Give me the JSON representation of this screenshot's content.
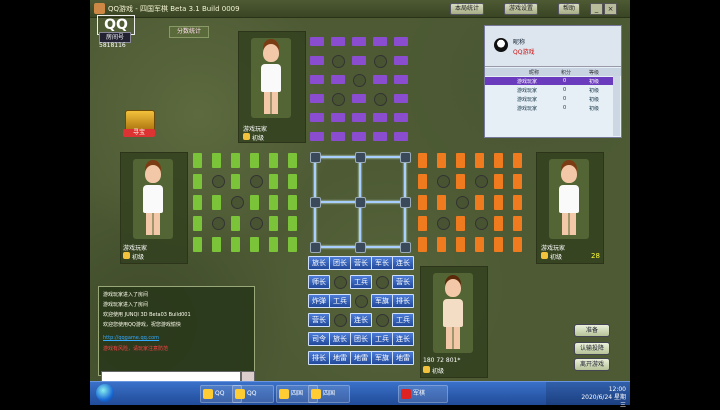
{
  "window": {
    "title": "QQ游戏 - 四国军棋   Beta 3.1 Build 0009",
    "buttons": [
      "本局统计",
      "游戏设置",
      "帮助"
    ]
  },
  "logo": "QQ",
  "room": {
    "badge": "房间号",
    "id": "5818116"
  },
  "stats_button": "分数统计",
  "treasure": {
    "label": "寻宝"
  },
  "players": {
    "top": {
      "name": "游戏玩家",
      "level": "初级"
    },
    "left": {
      "name": "游戏玩家",
      "level": "初级"
    },
    "right": {
      "name": "游戏玩家",
      "level": "初级",
      "count": "28"
    },
    "bottom": {
      "name": "180 72 801*",
      "level": "初级"
    }
  },
  "pieces": [
    [
      "旅长",
      "团长",
      "营长",
      "军长",
      "连长"
    ],
    [
      "师长",
      "",
      "工兵",
      "",
      "营长"
    ],
    [
      "炸弹",
      "工兵",
      "",
      "军旗",
      "排长"
    ],
    [
      "营长",
      "",
      "连长",
      "",
      "工兵"
    ],
    [
      "司令",
      "旅长",
      "团长",
      "工兵",
      "连长"
    ],
    [
      "排长",
      "地雷",
      "地雷",
      "军旗",
      "地雷"
    ]
  ],
  "player_list": {
    "title": "昵称",
    "subtitle": "QQ游戏",
    "columns": [
      "昵称",
      "积分",
      "等级"
    ],
    "rows": [
      {
        "name": "游戏玩家",
        "score": "0",
        "level": "初级"
      },
      {
        "name": "游戏玩家",
        "score": "0",
        "level": "初级"
      },
      {
        "name": "游戏玩家",
        "score": "0",
        "level": "初级"
      },
      {
        "name": "游戏玩家",
        "score": "0",
        "level": "初级"
      }
    ]
  },
  "chat": [
    {
      "text": "游戏玩家进入了房间",
      "style": "normal"
    },
    {
      "text": "游戏玩家进入了房间",
      "style": "normal"
    },
    {
      "text": "欢迎使用 JUNQI 3D  Beta03 Build001",
      "style": "normal"
    },
    {
      "text": "欢迎您使用QQ游戏，祝您游戏愉快",
      "style": "normal"
    },
    {
      "text": "http://qqgame.qq.com",
      "style": "link"
    },
    {
      "text": "游戏有风险，请玩家注意防范",
      "style": "red"
    }
  ],
  "side_buttons": [
    "准备",
    "认输投降",
    "离开游戏"
  ],
  "taskbar": {
    "items": [
      "QQ",
      "QQ",
      "四国",
      "四国",
      "军棋"
    ],
    "clock_time": "12:00",
    "clock_date": "2020/6/24 星期三"
  },
  "colors": {
    "purple": "#8a4dd0",
    "green": "#7bc43a",
    "orange": "#f07a1e",
    "blue_piece": "#3462c0",
    "rail": "#a8cfff"
  }
}
